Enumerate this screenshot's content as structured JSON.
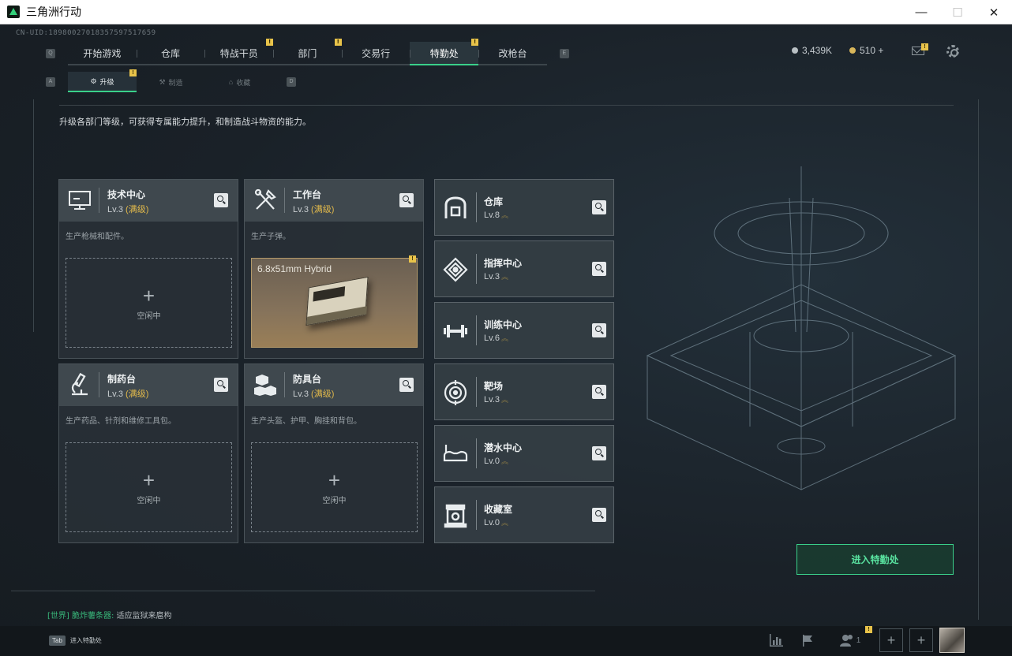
{
  "window": {
    "title": "三角洲行动",
    "controls": [
      "—",
      "☐",
      "✕"
    ]
  },
  "uid": "CN-UID:18980027018357597517659",
  "nav": {
    "left_key": "Q",
    "right_key": "E",
    "tabs": [
      {
        "label": "开始游戏",
        "badge": ""
      },
      {
        "label": "仓库",
        "badge": ""
      },
      {
        "label": "特战干员",
        "badge": "!"
      },
      {
        "label": "部门",
        "badge": "!"
      },
      {
        "label": "交易行",
        "badge": ""
      },
      {
        "label": "特勤处",
        "badge": "!",
        "active": true
      },
      {
        "label": "改枪台",
        "badge": ""
      }
    ]
  },
  "currency": {
    "silver": "3,439K",
    "gold": "510 +"
  },
  "mail_badge": "!",
  "subnav": {
    "left_key": "A",
    "right_key": "D",
    "tabs": [
      {
        "label": "升级",
        "icon": "⚙",
        "active": true,
        "badge": "!"
      },
      {
        "label": "制造",
        "icon": "⚒",
        "active": false
      },
      {
        "label": "收藏",
        "icon": "⌂",
        "active": false
      }
    ]
  },
  "description": "升级各部门等级，可获得专属能力提升，和制造战斗物资的能力。",
  "workshops": [
    {
      "name": "技术中心",
      "level": "Lv.3",
      "status": "(满级)",
      "desc": "生产枪械和配件。",
      "slot": "空闲中",
      "icon": "monitor-icon"
    },
    {
      "name": "工作台",
      "level": "Lv.3",
      "status": "(满级)",
      "desc": "生产子弹。",
      "slot_item": "6.8x51mm Hybrid",
      "slot_badge": "!",
      "icon": "tools-icon"
    },
    {
      "name": "制药台",
      "level": "Lv.3",
      "status": "(满级)",
      "desc": "生产药品、针剂和维修工具包。",
      "slot": "空闲中",
      "icon": "microscope-icon"
    },
    {
      "name": "防具台",
      "level": "Lv.3",
      "status": "(满级)",
      "desc": "生产头盔、护甲、胸挂和背包。",
      "slot": "空闲中",
      "icon": "cubes-icon"
    }
  ],
  "facilities": [
    {
      "name": "仓库",
      "level": "Lv.8",
      "icon": "warehouse-icon"
    },
    {
      "name": "指挥中心",
      "level": "Lv.3",
      "icon": "command-icon"
    },
    {
      "name": "训练中心",
      "level": "Lv.6",
      "icon": "dumbbell-icon"
    },
    {
      "name": "靶场",
      "level": "Lv.3",
      "icon": "target-icon"
    },
    {
      "name": "潜水中心",
      "level": "Lv.0",
      "icon": "goggles-icon"
    },
    {
      "name": "收藏室",
      "level": "Lv.0",
      "icon": "trophy-icon"
    }
  ],
  "enter_button": "进入特勤处",
  "chat": {
    "channel": "[世界]",
    "sender": "脆炸薯条器:",
    "message": "适应监狱来扈构"
  },
  "tab_hint": {
    "key": "Tab",
    "label": "进入特勤处"
  },
  "bottom": {
    "friends_count": "1",
    "friends_badge": "!",
    "add": "+"
  },
  "colors": {
    "accent": "#3ad08a",
    "badge": "#e8c34a",
    "maxed": "#e1b94b"
  }
}
